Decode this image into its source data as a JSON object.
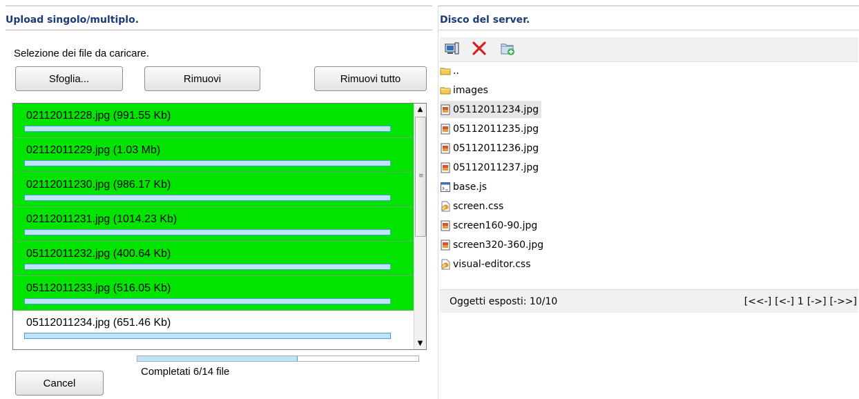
{
  "left": {
    "title": "Upload singolo/multiplo.",
    "select_label": "Selezione dei file da caricare.",
    "buttons": {
      "browse": "Sfoglia...",
      "remove": "Rimuovi",
      "remove_all": "Rimuovi tutto",
      "cancel": "Cancel"
    },
    "files": [
      {
        "label": "02112011228.jpg (991.55 Kb)",
        "state": "done",
        "progress": 1.0
      },
      {
        "label": "02112011229.jpg (1.03 Mb)",
        "state": "done",
        "progress": 1.0
      },
      {
        "label": "02112011230.jpg (986.17 Kb)",
        "state": "done",
        "progress": 1.0
      },
      {
        "label": "02112011231.jpg (1014.23 Kb)",
        "state": "done",
        "progress": 1.0
      },
      {
        "label": "05112011232.jpg (400.64 Kb)",
        "state": "done",
        "progress": 1.0
      },
      {
        "label": "05112011233.jpg (516.05 Kb)",
        "state": "done",
        "progress": 1.0
      },
      {
        "label": "05112011234.jpg (651.46 Kb)",
        "state": "pending",
        "progress": 1.0
      }
    ],
    "total": {
      "text": "Completati 6/14 file",
      "progress": 0.57
    }
  },
  "right": {
    "title": "Disco del server.",
    "toolbar": {
      "icons": [
        "server-icon",
        "delete-icon",
        "new-folder-icon"
      ]
    },
    "items": [
      {
        "label": "..",
        "icon": "folder-icon"
      },
      {
        "label": "images",
        "icon": "folder-icon"
      },
      {
        "label": "05112011234.jpg",
        "icon": "image-file-icon",
        "selected": true
      },
      {
        "label": "05112011235.jpg",
        "icon": "image-file-icon"
      },
      {
        "label": "05112011236.jpg",
        "icon": "image-file-icon"
      },
      {
        "label": "05112011237.jpg",
        "icon": "image-file-icon"
      },
      {
        "label": "base.js",
        "icon": "script-file-icon"
      },
      {
        "label": "screen.css",
        "icon": "css-file-icon"
      },
      {
        "label": "screen160-90.jpg",
        "icon": "image-file-icon"
      },
      {
        "label": "screen320-360.jpg",
        "icon": "image-file-icon"
      },
      {
        "label": "visual-editor.css",
        "icon": "css-file-icon"
      }
    ],
    "footer": {
      "count": "Oggetti esposti: 10/10",
      "pager": [
        "[<<-]",
        "[<-]",
        "1",
        "[->]",
        "[->>]"
      ]
    }
  },
  "colors": {
    "title": "#1b3b7d",
    "done": "#00e400",
    "progress_fill": "#bde4f8",
    "progress_border": "#4f9bd0"
  }
}
